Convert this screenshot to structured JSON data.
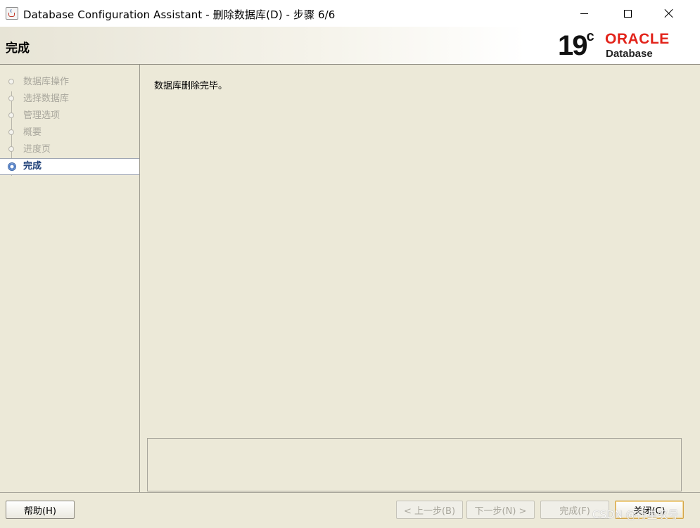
{
  "window": {
    "title": "Database Configuration Assistant - 删除数据库(D) - 步骤 6/6",
    "minimize_symbol": "—",
    "maximize_symbol": "☐",
    "close_symbol": "✕"
  },
  "header": {
    "title": "完成",
    "logo_version": "19",
    "logo_version_sup": "c",
    "logo_brand": "ORACLE",
    "logo_product": "Database",
    "brand_color": "#e2231a"
  },
  "sidebar": {
    "steps": [
      {
        "label": "数据库操作",
        "state": "done"
      },
      {
        "label": "选择数据库",
        "state": "done"
      },
      {
        "label": "管理选项",
        "state": "done"
      },
      {
        "label": "概要",
        "state": "done"
      },
      {
        "label": "进度页",
        "state": "done"
      },
      {
        "label": "完成",
        "state": "active"
      }
    ]
  },
  "main": {
    "message": "数据库删除完毕。"
  },
  "footer": {
    "help_label": "帮助(H)",
    "back_label": "< 上一步(B)",
    "next_label": "下一步(N) >",
    "finish_label": "完成(F)",
    "close_label": "关闭(C)"
  },
  "watermark": "CSDN @行星叹号"
}
